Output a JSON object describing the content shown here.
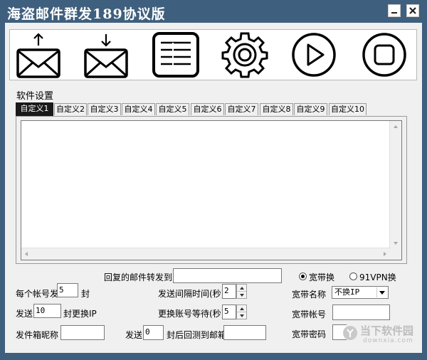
{
  "window": {
    "title": "海盗邮件群发189协议版",
    "minimize_icon": "minimize-icon",
    "close_icon": "close-icon"
  },
  "toolbar": {
    "buttons": [
      {
        "name": "send-button",
        "icon": "mail-upload-icon"
      },
      {
        "name": "receive-button",
        "icon": "mail-download-icon"
      },
      {
        "name": "list-button",
        "icon": "list-icon"
      },
      {
        "name": "settings-button",
        "icon": "gear-icon"
      },
      {
        "name": "start-button",
        "icon": "play-icon"
      },
      {
        "name": "stop-button",
        "icon": "stop-icon"
      }
    ]
  },
  "software_settings": {
    "label": "软件设置",
    "tabs": [
      "自定义1",
      "自定义2",
      "自定义3",
      "自定义4",
      "自定义5",
      "自定义6",
      "自定义7",
      "自定义8",
      "自定义9",
      "自定义10"
    ],
    "active_tab": 0,
    "content": ""
  },
  "form": {
    "forward_label": "回复的邮件转发到:",
    "forward_value": "",
    "radio_broadband": "宽带换",
    "radio_vpn": "91VPN换",
    "per_account_label": "每个帐号发",
    "per_account_value": "5",
    "per_account_unit": "封",
    "send_label": "发送",
    "send_value": "10",
    "send_unit": "封更换IP",
    "sender_nick_label": "发件箱昵称",
    "sender_nick_value": "",
    "interval_label": "发送间隔时间(秒)",
    "interval_value": "2",
    "switch_wait_label": "更换账号等待(秒)",
    "switch_wait_value": "5",
    "send2_label": "发送",
    "send2_value": "0",
    "backtest_label": "封后回测到邮箱",
    "backtest_value": "",
    "bb_name_label": "宽带名称",
    "bb_name_value": "不换IP",
    "bb_account_label": "宽带帐号",
    "bb_account_value": "",
    "bb_password_label": "宽带密码",
    "bb_password_value": ""
  },
  "watermark": {
    "text": "当下软件园",
    "url": "downxia.com"
  }
}
